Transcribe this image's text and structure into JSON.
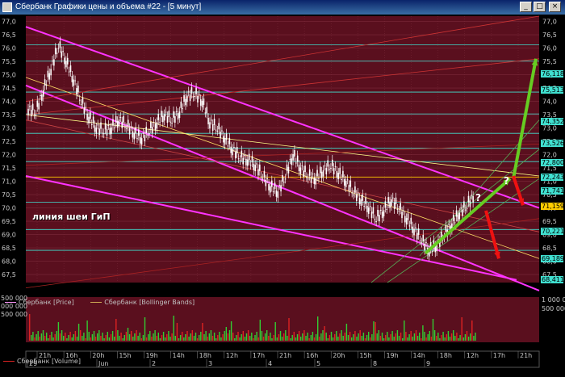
{
  "window": {
    "title": "Сбербанк Графики цены и объема #22 - [5 минут]",
    "minimize": "_",
    "maximize": "□",
    "close": "×"
  },
  "colors": {
    "plot_bg": "#5a0f1e",
    "grid": "#7a2a3a",
    "candle": "#ffffff",
    "channel": "#ff33ff",
    "level": "#40e0d0",
    "arrow_up": "#66cc22",
    "arrow_down": "#ee1111",
    "volume_up": "#33cc33",
    "volume_down": "#dd2222"
  },
  "annotation": {
    "neckline": "линия шеи ГиП",
    "question1": "?",
    "question2": "?"
  },
  "chart_data": {
    "type": "candlestick",
    "y_ticks": [
      "77,0",
      "76,5",
      "76,0",
      "75,5",
      "75,0",
      "74,5",
      "74,0",
      "73,5",
      "73,0",
      "72,5",
      "72,0",
      "71,5",
      "71,0",
      "70,5",
      "70,0",
      "69,5",
      "69,0",
      "68,5",
      "68,0",
      "67,5"
    ],
    "ylim": [
      67.2,
      77.2
    ],
    "price_labels": [
      {
        "text": "76,1181",
        "value": 76.12,
        "bg": "#40e0d0"
      },
      {
        "text": "75,5133",
        "value": 75.51,
        "bg": "#40e0d0"
      },
      {
        "text": "74,3524",
        "value": 74.35,
        "bg": "#40e0d0"
      },
      {
        "text": "73,5263",
        "value": 73.53,
        "bg": "#40e0d0"
      },
      {
        "text": "72,8008",
        "value": 72.8,
        "bg": "#40e0d0"
      },
      {
        "text": "72,2431",
        "value": 72.24,
        "bg": "#40e0d0"
      },
      {
        "text": "71,7412",
        "value": 71.74,
        "bg": "#40e0d0"
      },
      {
        "text": "71,1590",
        "value": 71.16,
        "bg": "#ffcc00"
      },
      {
        "text": "70,2215",
        "value": 70.22,
        "bg": "#40e0d0"
      },
      {
        "text": "69,1890",
        "value": 69.19,
        "bg": "#40e0d0"
      },
      {
        "text": "68,4114",
        "value": 68.41,
        "bg": "#40e0d0"
      }
    ],
    "series_legend": [
      "Сбербанк [Price]",
      "Сбербанк [Bollinger Bands]"
    ],
    "volume_legend": "Сбербанк [Volume]",
    "volume_ticks_left": [
      "500 000",
      "000 000",
      "500 000"
    ],
    "volume_ticks_right": [
      "1 000 00",
      "500 000"
    ],
    "time_ticks": [
      "21h",
      "16h",
      "20h",
      "15h",
      "19h",
      "14h",
      "18h",
      "12h",
      "17h",
      "21h",
      "16h",
      "20h",
      "15h",
      "19h",
      "14h",
      "18h",
      "12h",
      "17h",
      "21h"
    ],
    "date_ticks": [
      "29",
      "Jun",
      "2",
      "3",
      "4",
      "5",
      "8",
      "9"
    ],
    "path": [
      73.7,
      73.6,
      74.4,
      75.2,
      76.1,
      75.5,
      74.8,
      74.0,
      73.4,
      73.0,
      72.9,
      73.0,
      73.3,
      73.1,
      72.8,
      72.6,
      72.9,
      73.2,
      73.5,
      73.3,
      73.6,
      74.2,
      74.3,
      74.0,
      73.2,
      73.0,
      72.6,
      72.2,
      71.9,
      71.8,
      71.6,
      71.2,
      70.8,
      70.6,
      71.2,
      72.0,
      71.5,
      71.2,
      71.1,
      71.4,
      71.6,
      71.3,
      71.0,
      70.6,
      70.3,
      70.0,
      69.6,
      69.9,
      70.3,
      70.0,
      69.6,
      69.2,
      68.8,
      68.4,
      68.6,
      69.0,
      69.4,
      69.8,
      70.1,
      70.5
    ]
  }
}
